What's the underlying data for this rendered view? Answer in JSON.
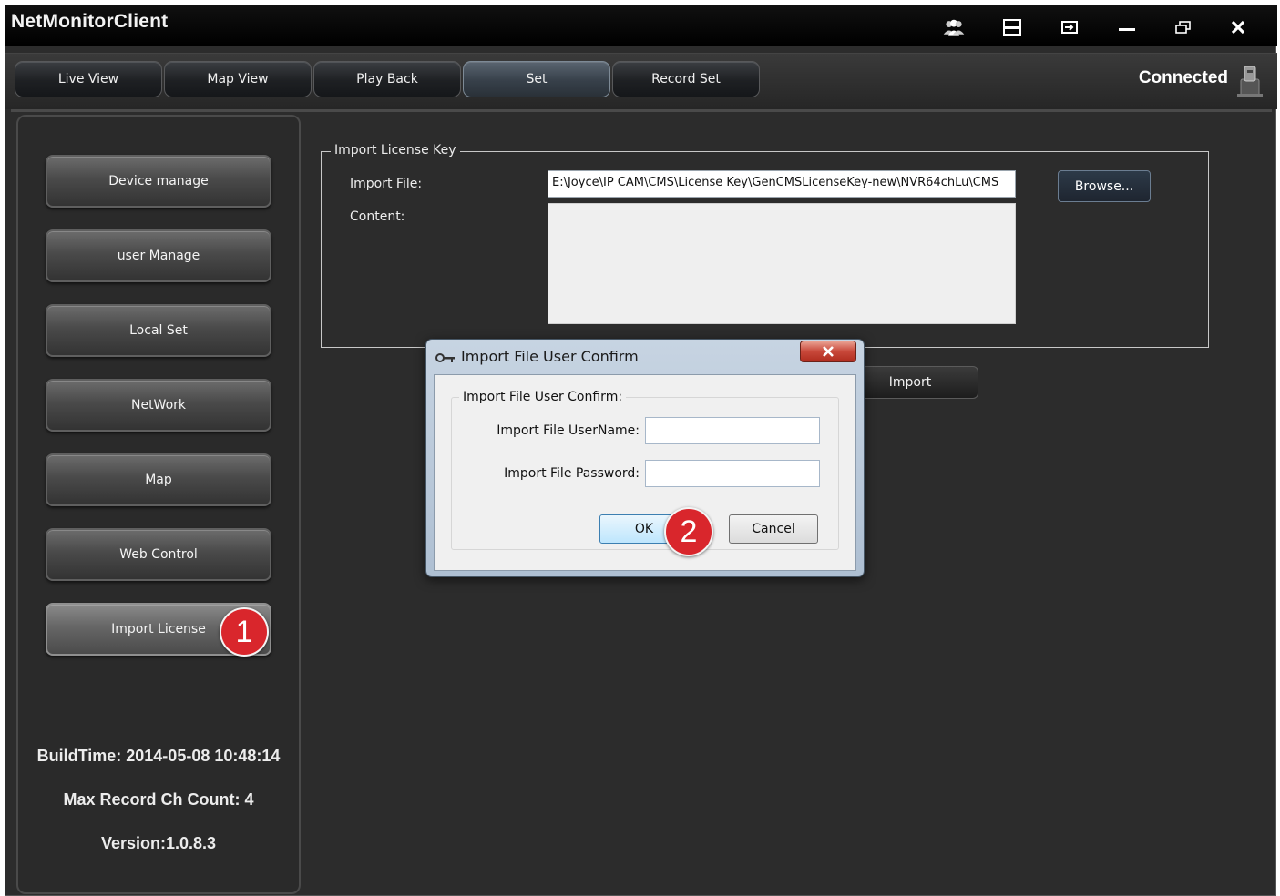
{
  "app": {
    "title": "NetMonitorClient",
    "window_controls": [
      "users-icon",
      "layout-icon",
      "exit-icon",
      "minimize-icon",
      "restore-icon",
      "close-icon"
    ]
  },
  "navbar": {
    "tabs": [
      {
        "label": "Live View"
      },
      {
        "label": "Map View"
      },
      {
        "label": "Play Back"
      },
      {
        "label": "Set",
        "active": true
      },
      {
        "label": "Record Set"
      }
    ],
    "status": "Connected",
    "status_icon": "network-status-icon"
  },
  "sidebar": {
    "items": [
      {
        "label": "Device manage"
      },
      {
        "label": "user Manage"
      },
      {
        "label": "Local Set"
      },
      {
        "label": "NetWork"
      },
      {
        "label": "Map"
      },
      {
        "label": "Web Control"
      },
      {
        "label": "Import License",
        "active": true
      }
    ],
    "build_time": "BuildTime: 2014-05-08 10:48:14",
    "max_record": "Max Record Ch Count: 4",
    "version": "Version:1.0.8.3"
  },
  "license": {
    "group_title": "Import License Key",
    "import_file_label": "Import File:",
    "import_file_value": "E:\\Joyce\\IP CAM\\CMS\\License Key\\GenCMSLicenseKey-new\\NVR64chLu\\CMS",
    "content_label": "Content:",
    "content_value": "",
    "browse_label": "Browse...",
    "import_label": "Import"
  },
  "dialog": {
    "title": "Import File User Confirm",
    "group_title": "Import File User Confirm:",
    "username_label": "Import File UserName:",
    "username_value": "",
    "password_label": "Import File Password:",
    "password_value": "",
    "ok_label": "OK",
    "cancel_label": "Cancel"
  },
  "annotations": {
    "step1": "1",
    "step2": "2"
  },
  "colors": {
    "background": "#2c2c2c",
    "badge": "#d9262c",
    "dialog_frame": "#b9c9da"
  }
}
